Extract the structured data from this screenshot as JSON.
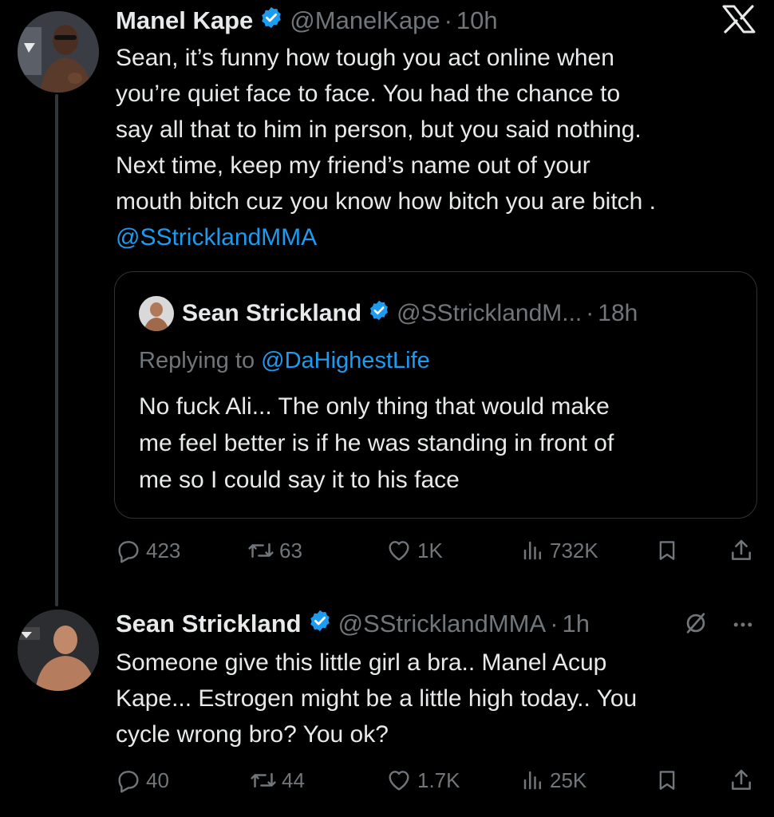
{
  "tweet1": {
    "name": "Manel Kape",
    "handle": "@ManelKape",
    "dot": "·",
    "time": "10h",
    "lines": [
      "Sean, it’s funny how tough you act online when",
      "you’re quiet face to face. You had the chance to",
      "say all that to him in person, but you said nothing.",
      "Next time, keep my friend’s name out of your",
      "mouth bitch cuz you know how bitch you are bitch ."
    ],
    "mention": "@SStricklandMMA",
    "stats": {
      "replies": "423",
      "reposts": "63",
      "likes": "1K",
      "views": "732K"
    }
  },
  "quote": {
    "name": "Sean Strickland",
    "handle": "@SStricklandM...",
    "dot": "·",
    "time": "18h",
    "replying_prefix": "Replying to",
    "replying_to": "@DaHighestLife",
    "lines": [
      "No fuck Ali... The only thing that would make",
      "me feel better is if he was standing in front of",
      "me so I could say it to his face"
    ]
  },
  "tweet2": {
    "name": "Sean Strickland",
    "handle": "@SStricklandMMA",
    "dot": "·",
    "time": "1h",
    "lines": [
      "Someone give this little girl a bra.. Manel Acup",
      "Kape... Estrogen might be a little high today.. You",
      "cycle wrong bro? You ok?"
    ],
    "stats": {
      "replies": "40",
      "reposts": "44",
      "likes": "1.7K",
      "views": "25K"
    }
  },
  "colors": {
    "background": "#000000",
    "text": "#e7e9ea",
    "muted": "#71767b",
    "link": "#1d9bf0",
    "verified": "#1d9bf0",
    "border": "#2f3336"
  }
}
